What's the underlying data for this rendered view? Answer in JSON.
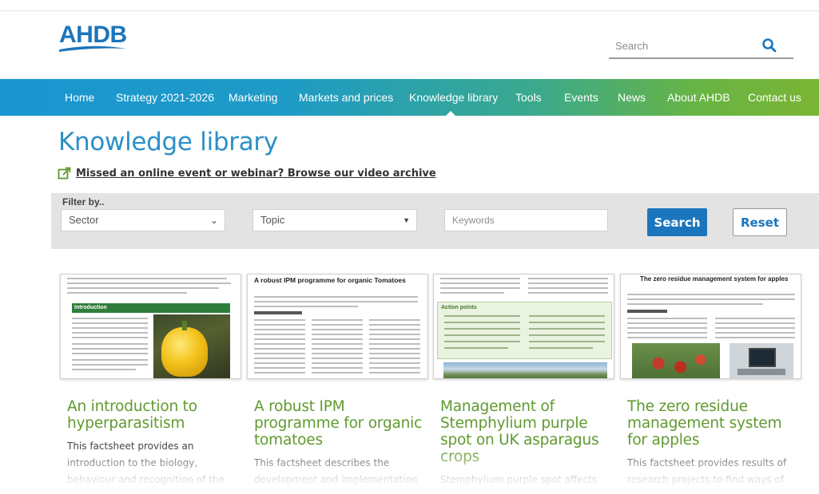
{
  "brand": {
    "logo_text": "AHDB",
    "accent": "#1b75bc",
    "green": "#5f9a2e"
  },
  "search": {
    "placeholder": "Search",
    "icon": "search-icon"
  },
  "nav": {
    "items": [
      {
        "label": "Home"
      },
      {
        "label": "Strategy 2021-2026"
      },
      {
        "label": "Marketing"
      },
      {
        "label": "Markets and prices"
      },
      {
        "label": "Knowledge library"
      },
      {
        "label": "Tools"
      },
      {
        "label": "Events"
      },
      {
        "label": "News"
      },
      {
        "label": "About AHDB"
      },
      {
        "label": "Contact us"
      }
    ],
    "active": "Knowledge library"
  },
  "page": {
    "title": "Knowledge library",
    "video_link": "Missed an online event or webinar? Browse our video archive",
    "video_link_icon": "external-link-icon"
  },
  "filter": {
    "label": "Filter by..",
    "sector": "Sector",
    "topic": "Topic",
    "keywords_placeholder": "Keywords",
    "search_label": "Search",
    "reset_label": "Reset"
  },
  "cards": [
    {
      "title": "An introduction to hyperparasitism",
      "desc": "This factsheet provides an introduction to the biology, behaviour and recognition of the main groups of",
      "thumb_heading": "Introduction"
    },
    {
      "title": "A robust IPM programme for organic tomatoes",
      "desc": "This factsheet describes the development and implementation of a",
      "thumb_heading": "A robust IPM programme for organic Tomatoes"
    },
    {
      "title": "Management of Stemphylium purple spot on UK asparagus crops",
      "desc": "Stemphylium purple spot affects",
      "thumb_heading": "Action points"
    },
    {
      "title": "The zero residue management system for apples",
      "desc": "This factsheet provides results of research projects to find ways of",
      "thumb_heading": "The zero residue management system for apples"
    }
  ]
}
